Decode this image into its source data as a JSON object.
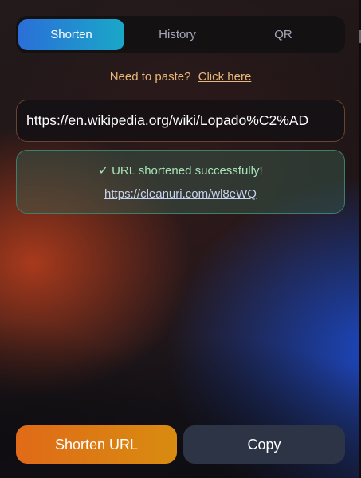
{
  "tabs": [
    {
      "label": "Shorten",
      "active": true
    },
    {
      "label": "History",
      "active": false
    },
    {
      "label": "QR",
      "active": false
    }
  ],
  "paste": {
    "prompt": "Need to paste?",
    "link_label": "Click here"
  },
  "url_input": {
    "value": "https://en.wikipedia.org/wiki/Lopado%C2%AD"
  },
  "result": {
    "message": "✓ URL shortened successfully!",
    "short_url": "https://cleanuri.com/wl8eWQ"
  },
  "actions": {
    "shorten_label": "Shorten URL",
    "copy_label": "Copy"
  },
  "colors": {
    "active_tab": "#2a6fd8",
    "paste_text": "#e8b878",
    "success_text": "#a8e4b8",
    "shorten_button": "#e06a18",
    "copy_button": "#2d3446"
  }
}
